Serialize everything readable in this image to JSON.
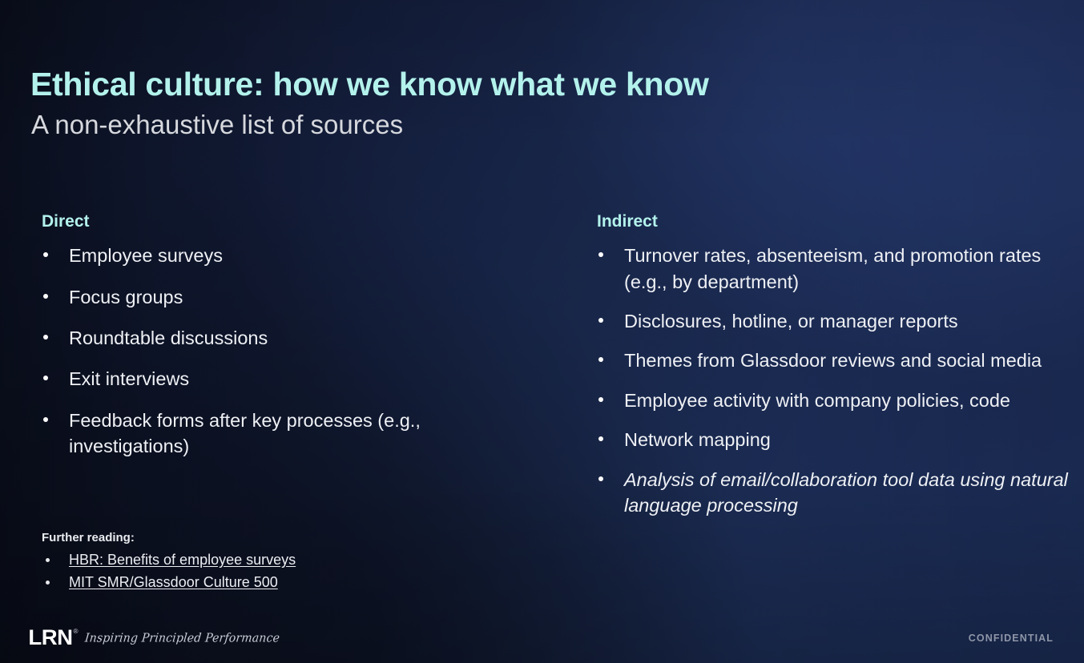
{
  "slide": {
    "title": "Ethical culture: how we know what we know",
    "subtitle": "A non-exhaustive list of sources",
    "accent_color": "#b3f2ec",
    "background_dark": "#0d1326",
    "background_light": "#1e3160",
    "body_text_color": "#eef0f4"
  },
  "columns": {
    "left": {
      "heading": "Direct",
      "items": [
        "Employee surveys",
        "Focus groups",
        "Roundtable discussions",
        "Exit interviews",
        "Feedback forms after key processes (e.g., investigations)"
      ]
    },
    "right": {
      "heading": "Indirect",
      "items": [
        "Turnover rates, absenteeism, and promotion rates (e.g., by department)",
        "Disclosures, hotline, or manager reports",
        "Themes from Glassdoor reviews and social media",
        "Employee activity with company policies, code",
        "Network mapping",
        "Analysis of email/collaboration tool data using natural language processing"
      ],
      "italic_items": [
        5
      ]
    }
  },
  "further_reading": {
    "heading": "Further reading:",
    "links": [
      "HBR: Benefits of employee surveys",
      "MIT SMR/Glassdoor Culture 500"
    ]
  },
  "footer": {
    "logo_text": "LRN",
    "logo_registered": "®",
    "tagline": "Inspiring Principled Performance",
    "confidential": "CONFIDENTIAL"
  }
}
